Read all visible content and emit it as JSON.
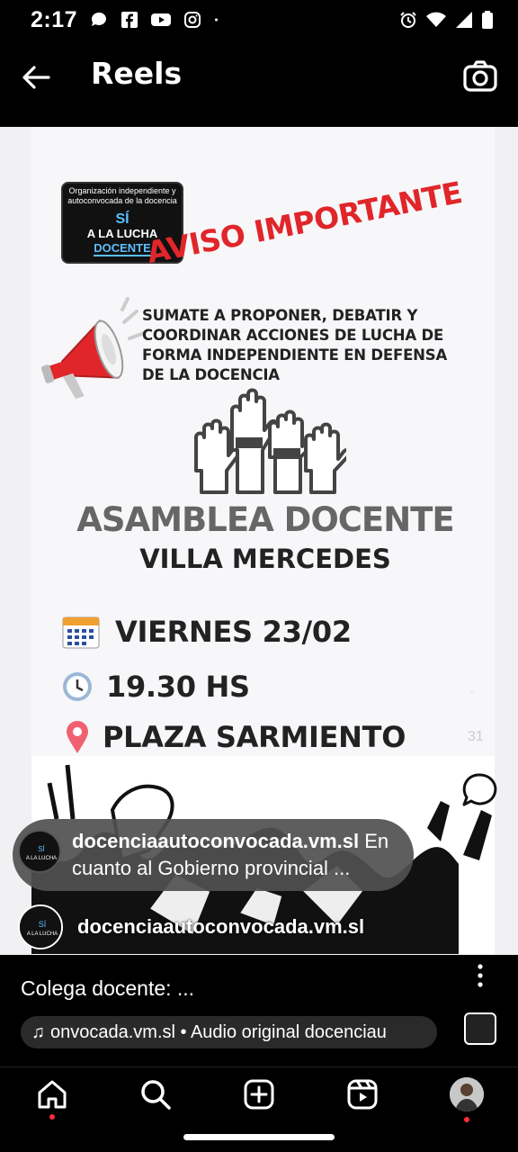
{
  "status_bar": {
    "time": "2:17",
    "notification_icons": [
      "chat-icon",
      "facebook-icon",
      "youtube-icon",
      "instagram-icon",
      "dot-icon"
    ],
    "system_icons": [
      "alarm-icon",
      "wifi-icon",
      "signal-icon",
      "battery-icon"
    ]
  },
  "header": {
    "title": "Reels",
    "back_icon": "back-arrow-icon",
    "camera_icon": "camera-icon"
  },
  "poster": {
    "logo_line1": "Organización independiente y",
    "logo_line2": "autoconvocada de la docencia",
    "logo_si": "SÍ",
    "logo_a_la_lucha": "A LA LUCHA",
    "logo_docente": "DOCENTE",
    "aviso": "AVISO IMPORTANTE",
    "sumate": "SUMATE A PROPONER, DEBATIR Y COORDINAR ACCIONES DE LUCHA DE FORMA INDEPENDIENTE EN DEFENSA DE LA DOCENCIA",
    "asamblea": "ASAMBLEA DOCENTE",
    "villa": "VILLA MERCEDES",
    "date": "VIERNES 23/02",
    "time": "19.30 HS",
    "place": "PLAZA SARMIENTO",
    "colors": {
      "red": "#e0262a",
      "gray": "#666666",
      "dark": "#222222"
    }
  },
  "overlay": {
    "side_count": "31",
    "comment_icon": "comment-icon",
    "caption_user": "docenciaautoconvocada.vm.sl",
    "caption_text_1": " En",
    "caption_text_2": "cuanto al Gobierno provincial ...",
    "username": "docenciaautoconvocada.vm.sl"
  },
  "footer": {
    "caption": "Colega docente: ...",
    "audio_text": "onvocada.vm.sl • Audio original   docenciau",
    "more_icon": "more-vertical-icon",
    "audio_note_icon": "music-note-icon"
  },
  "nav": {
    "items": [
      "home-icon",
      "search-icon",
      "create-icon",
      "reels-icon",
      "profile-avatar"
    ],
    "accent": "#ff2d3a"
  }
}
